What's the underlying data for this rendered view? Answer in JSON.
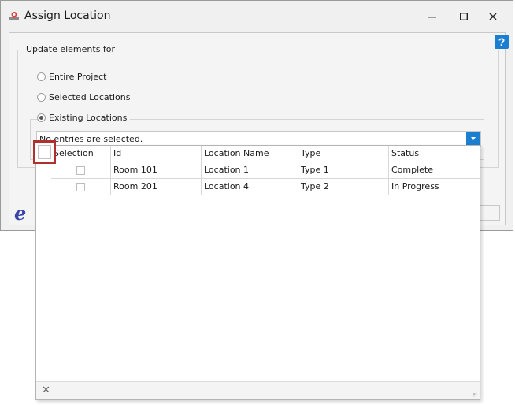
{
  "window": {
    "title": "Assign Location",
    "icon": "app-icon"
  },
  "help": {
    "label": "?"
  },
  "group": {
    "legend": "Update elements for",
    "options": [
      {
        "label": "Entire Project",
        "checked": false
      },
      {
        "label": "Selected Locations",
        "checked": false
      },
      {
        "label": "Existing Locations",
        "checked": true
      }
    ]
  },
  "combo": {
    "text": "No entries are selected."
  },
  "grid": {
    "columns": [
      "Selection",
      "Id",
      "Location Name",
      "Type",
      "Status"
    ],
    "rows": [
      {
        "selected": false,
        "id": "Room 101",
        "name": "Location 1",
        "type": "Type 1",
        "status": "Complete"
      },
      {
        "selected": false,
        "id": "Room 201",
        "name": "Location 4",
        "type": "Type 2",
        "status": "In Progress"
      }
    ]
  },
  "colors": {
    "accent": "#1b7fd1",
    "highlight_border": "#b03030",
    "logo": "#3a46a8"
  }
}
